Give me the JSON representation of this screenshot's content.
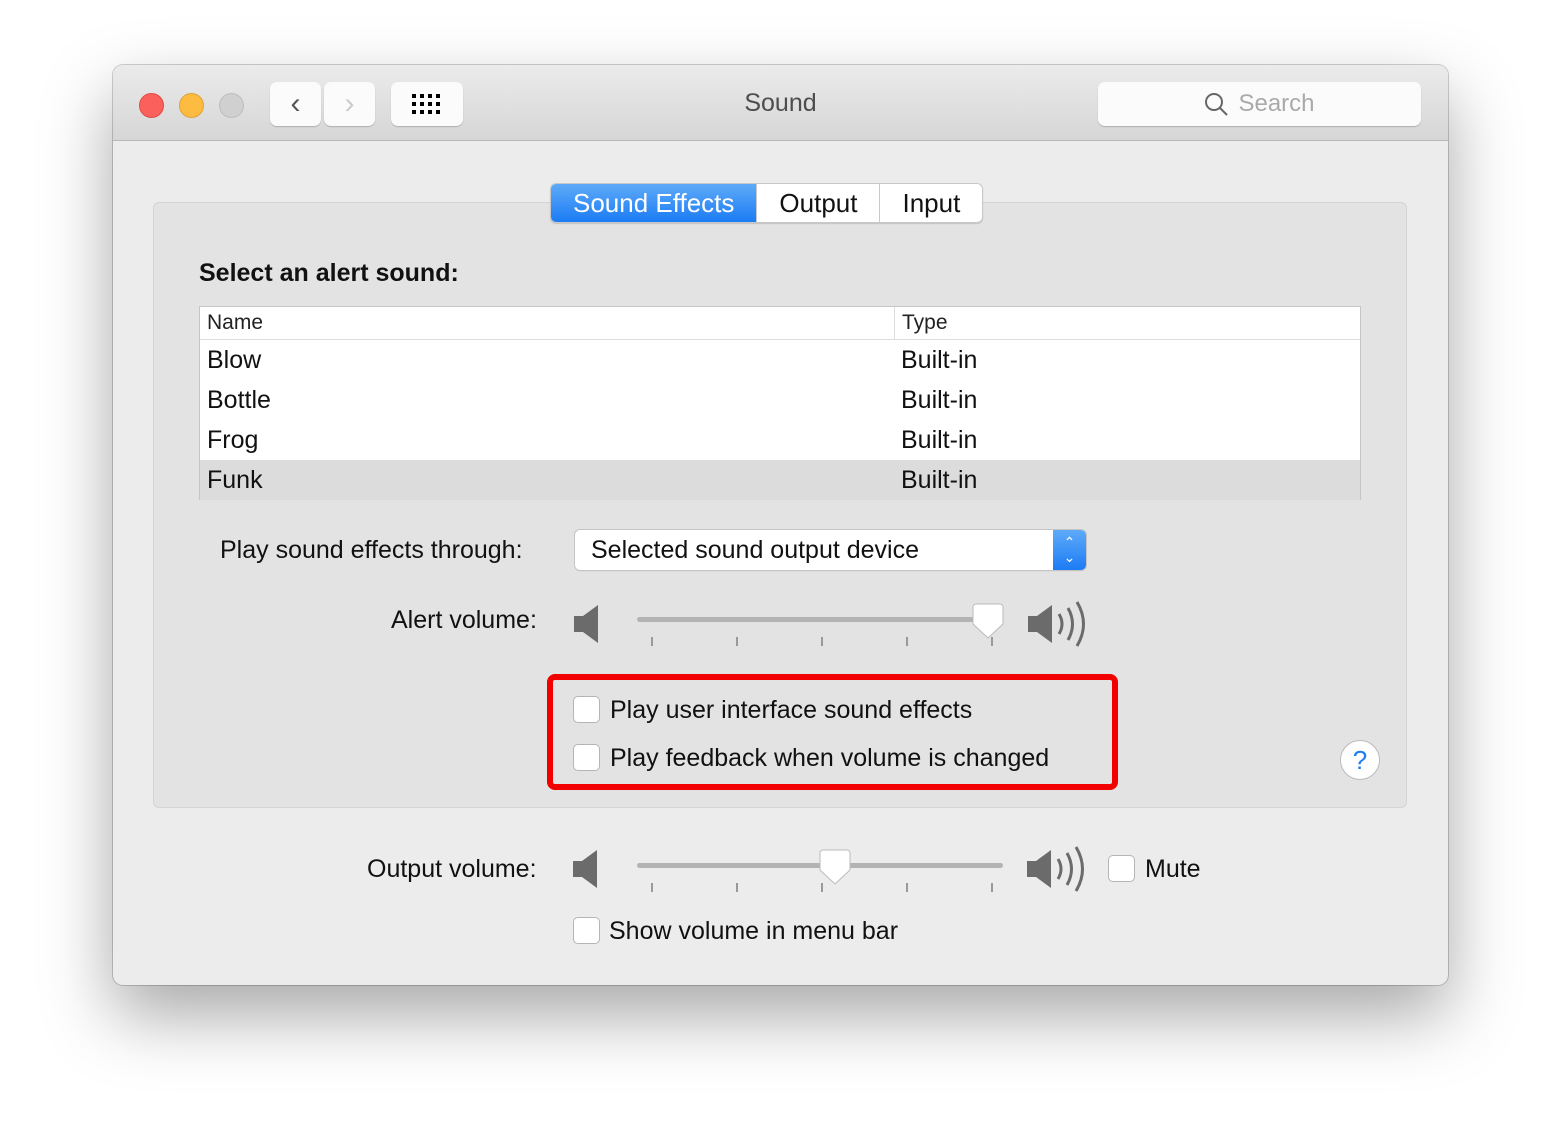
{
  "window": {
    "title": "Sound",
    "search_placeholder": "Search",
    "icons": [
      "close",
      "minimize",
      "zoom",
      "chevron-left",
      "chevron-right",
      "grid",
      "search"
    ]
  },
  "tabs": [
    {
      "label": "Sound Effects",
      "active": true
    },
    {
      "label": "Output",
      "active": false
    },
    {
      "label": "Input",
      "active": false
    }
  ],
  "sound_effects": {
    "heading": "Select an alert sound:",
    "columns": [
      "Name",
      "Type"
    ],
    "rows": [
      [
        "Blow",
        "Built-in"
      ],
      [
        "Bottle",
        "Built-in"
      ],
      [
        "Frog",
        "Built-in"
      ],
      [
        "Funk",
        "Built-in"
      ]
    ],
    "selected_row": "Funk",
    "play_through_label": "Play sound effects through:",
    "play_through_value": "Selected sound output device",
    "alert_volume_label": "Alert volume:",
    "alert_volume": 0.96,
    "checkboxes": [
      {
        "label": "Play user interface sound effects",
        "checked": false
      },
      {
        "label": "Play feedback when volume is changed",
        "checked": false
      }
    ],
    "help": "?"
  },
  "output": {
    "label": "Output volume:",
    "volume": 0.54,
    "mute_label": "Mute",
    "mute": false,
    "menu_bar_label": "Show volume in menu bar",
    "menu_bar": false
  },
  "colors": {
    "accent": "#1c7cf4",
    "highlight": "#f20000",
    "close": "#fc605c",
    "minimize": "#fdbc40",
    "zoom": "#d0d0d0"
  }
}
